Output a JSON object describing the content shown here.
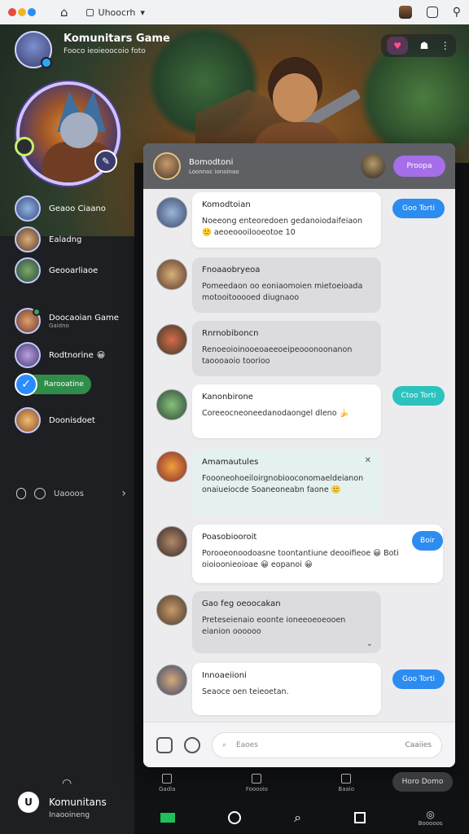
{
  "browser": {
    "tab_label": "Uhoocrh",
    "colors": [
      "#e84b3c",
      "#f0b429",
      "#2d8cf0"
    ]
  },
  "header": {
    "server_title": "Komunitars Game",
    "server_sub": "Fooco ieoieoocoio foto"
  },
  "sidebar": {
    "items": [
      {
        "label": "Geaoo Ciaano",
        "sub": ""
      },
      {
        "label": "Ealadng",
        "sub": ""
      },
      {
        "label": "Geooarliaoe",
        "sub": ""
      },
      {
        "label": "Doocaoian Game",
        "sub": "Gaidno"
      },
      {
        "label": "Rodtnorine",
        "sub": ""
      },
      {
        "label": "Rarooatine",
        "sub": ""
      },
      {
        "label": "Doonisdoet",
        "sub": ""
      }
    ],
    "controls_label": "Uaooos",
    "footer_name": "Komunitans",
    "footer_sub": "Inaooineng"
  },
  "panel": {
    "header_title": "Bomodtoni",
    "header_sub": "Loonnoc ionoinao",
    "header_button": "Proopa",
    "messages": [
      {
        "name": "Komodtoian",
        "text": "Noeeong enteoredoen gedanoiodaifeiaon 🙂 aeoeoooilooeotoe 10",
        "action": "Goo Torti",
        "style": "white"
      },
      {
        "name": "Fnoaaobryeoa",
        "text": "Pomeedaon oo eoniaomoien mietoeioada motooitooooed diugnaoo",
        "action": "",
        "style": "grey"
      },
      {
        "name": "Rnrnobiboncn",
        "text": "Renoeoioinooeoaeeoeipeooonoonanon taoooaoio toorioo",
        "action": "",
        "style": "grey"
      },
      {
        "name": "Kanonbirone",
        "text": "Coreeocneoneedanodaongel dleno 🍌",
        "action": "Ctoo Torti",
        "style": "white"
      },
      {
        "name": "Amamautules",
        "text": "Foooneohoeiloirgnobiooconomaeldeianon onaiueiocde Soaneoneabn faone 🙂",
        "action": "",
        "style": "mint"
      },
      {
        "name": "Poasobiooroit",
        "text": "Porooeonoodoasne toontantiune deooifieoe 😀 Boti oioioonieoioae 😀 eopanoi 😀",
        "action": "Boir",
        "style": "white"
      },
      {
        "name": "Gao feg oeoocakan",
        "text": "Preteseienaio eoonte ioneeoeoeooen eianion oooooo",
        "action": "",
        "style": "grey"
      },
      {
        "name": "Innoaeiioni",
        "text": "Seaoce oen teieoetan.",
        "action": "Goo Torti",
        "style": "white"
      }
    ],
    "composer_placeholder": "Eaoes",
    "composer_send": "Caaiies"
  },
  "subnav": [
    "Gadia",
    "Fooooio",
    "Baaio"
  ],
  "home_button": "Horo Domo",
  "bottombar_label": "Booooos"
}
